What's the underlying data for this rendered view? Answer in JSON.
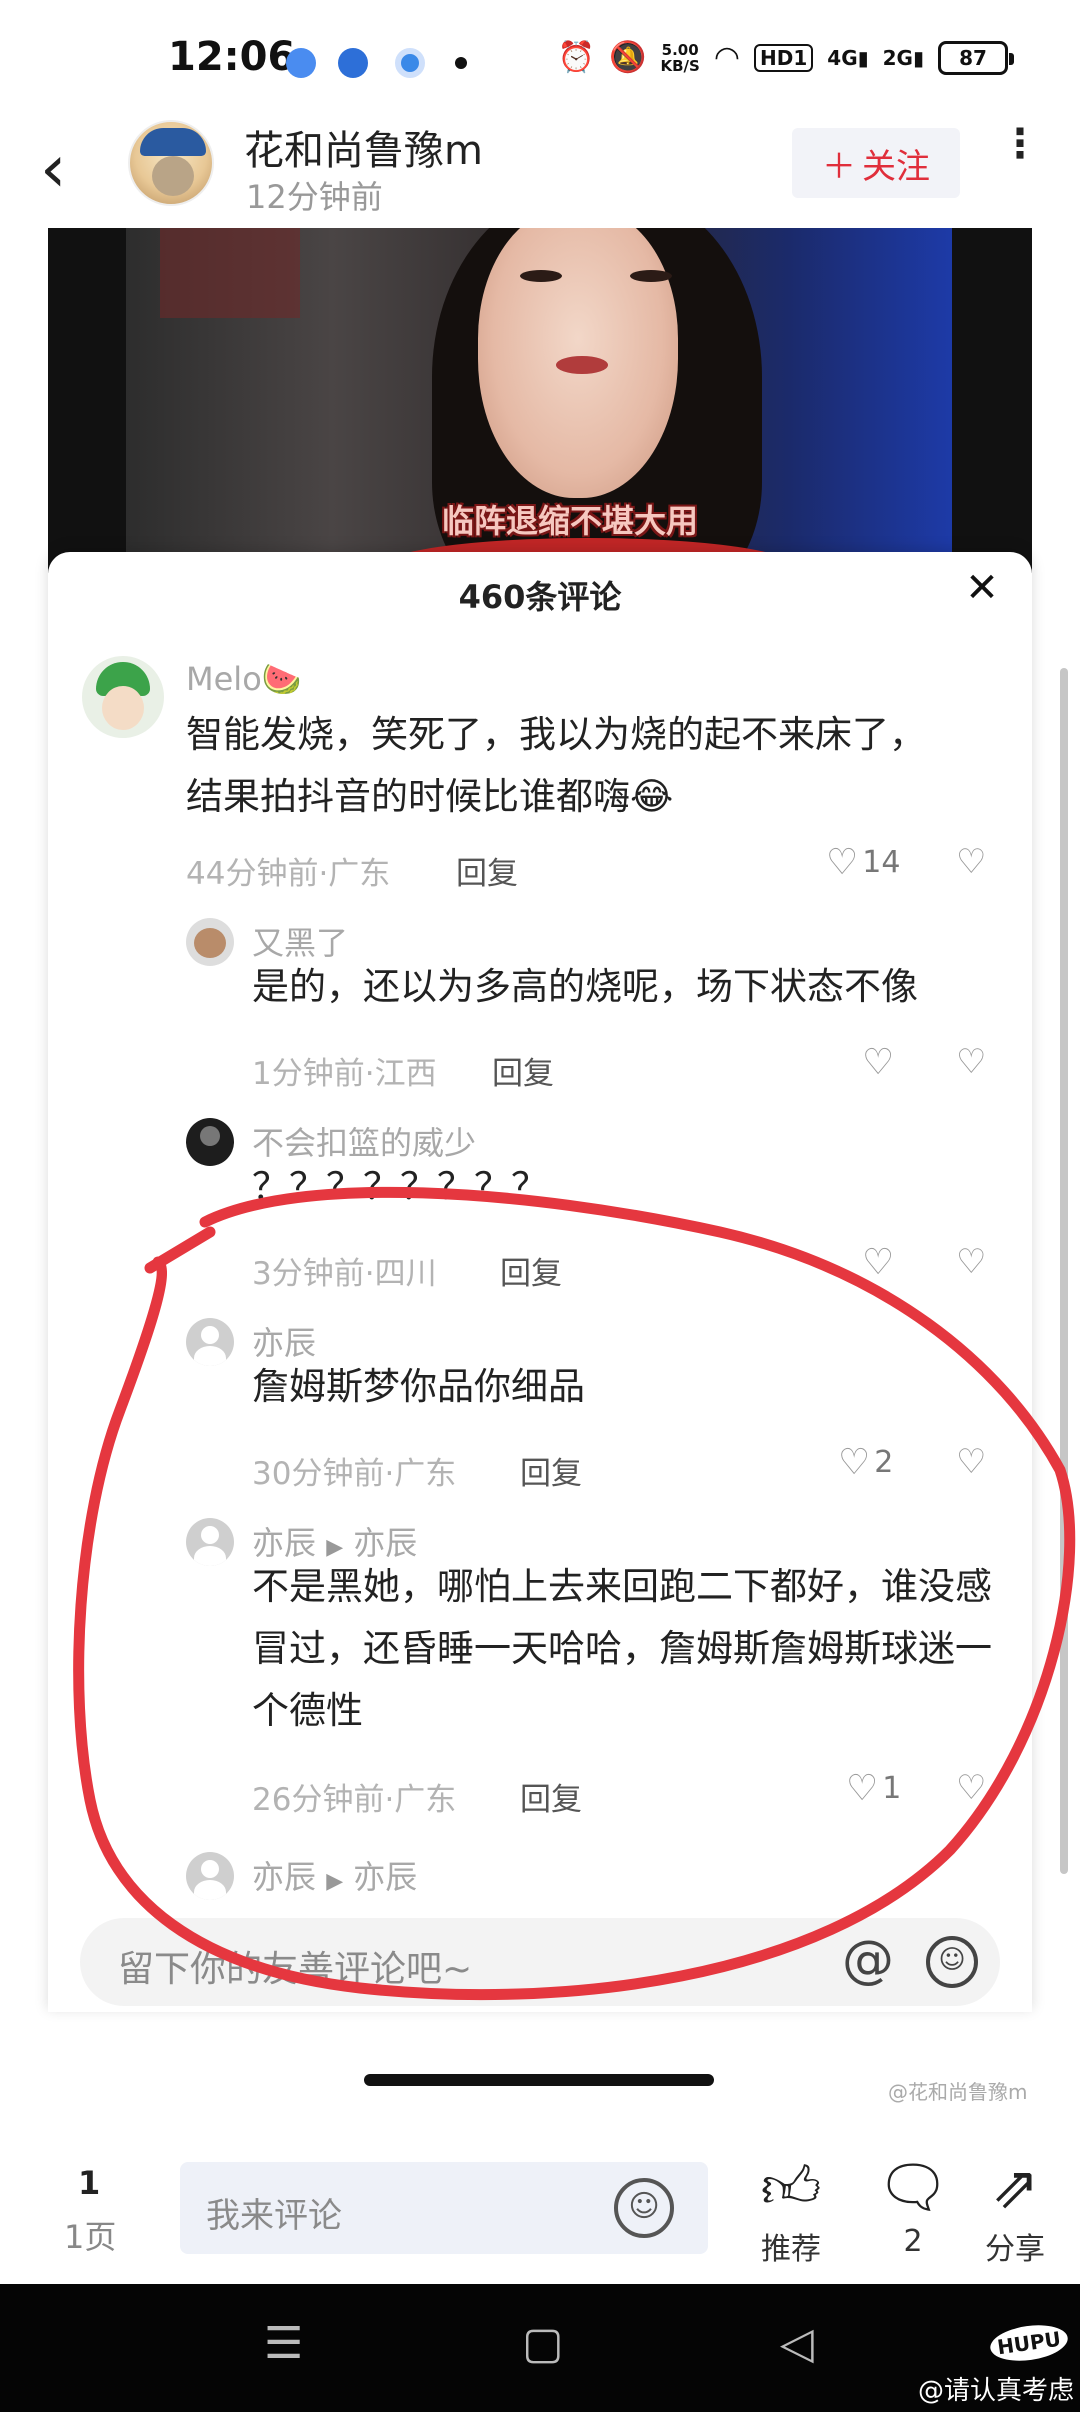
{
  "status_bar": {
    "time": "12:06",
    "net_speed_value": "5.00",
    "net_speed_unit": "KB/S",
    "hd_tag": "HD1",
    "sig1": "4G",
    "sig2": "2G",
    "battery": "87",
    "icons": [
      "baidu-app-icon",
      "baidu-paw-icon",
      "app-circle-icon",
      "alarm-icon",
      "mute-icon",
      "wifi-icon"
    ]
  },
  "header": {
    "back_glyph": "‹",
    "username": "花和尚鲁豫m",
    "post_time": "12分钟前",
    "follow_label": "关注",
    "follow_plus": "＋",
    "more_glyph": "⋮"
  },
  "video": {
    "caption": "临阵退缩不堪大用"
  },
  "comments_panel": {
    "title": "460条评论",
    "close_glyph": "✕",
    "comments": [
      {
        "name": "Melo🍉",
        "text": "智能发烧，笑死了，我以为烧的起不来床了，结果拍抖音的时候比谁都嗨😂",
        "meta": "44分钟前·广东",
        "reply": "回复",
        "likes": "14"
      },
      {
        "name": "又黑了",
        "text": "是的，还以为多高的烧呢，场下状态不像",
        "meta": "1分钟前·江西",
        "reply": "回复",
        "likes": ""
      },
      {
        "name": "不会扣篮的威少",
        "text": "？？？？？？？？",
        "meta": "3分钟前·四川",
        "reply": "回复",
        "likes": ""
      },
      {
        "name": "亦辰",
        "text": "詹姆斯梦你品你细品",
        "meta": "30分钟前·广东",
        "reply": "回复",
        "likes": "2"
      },
      {
        "name": "亦辰",
        "reply_to": "亦辰",
        "text": "不是黑她，哪怕上去来回跑二下都好，谁没感冒过，还昏睡一天哈哈，詹姆斯詹姆斯球迷一个德性",
        "meta": "26分钟前·广东",
        "reply": "回复",
        "likes": "1"
      },
      {
        "name": "亦辰",
        "reply_to": "亦辰"
      }
    ],
    "input_placeholder": "留下你的友善评论吧~",
    "at_glyph": "@",
    "emoji_glyph": "☺"
  },
  "watermark_inner": "@花和尚鲁豫m",
  "toolbar": {
    "page_number": "1",
    "page_label": "1页",
    "comment_placeholder": "我来评论",
    "emoji_glyph": "☺",
    "recommend_label": "推荐",
    "comment_count": "2",
    "share_label": "分享"
  },
  "navbar": {
    "menu_glyph": "☰",
    "home_glyph": "▢",
    "back_glyph": "◁"
  },
  "branding": {
    "hupu_logo": "HUPU",
    "watermark": "@请认真考虑"
  },
  "colors": {
    "accent_red": "#e02e3b",
    "annotation_red": "#e5373f"
  }
}
